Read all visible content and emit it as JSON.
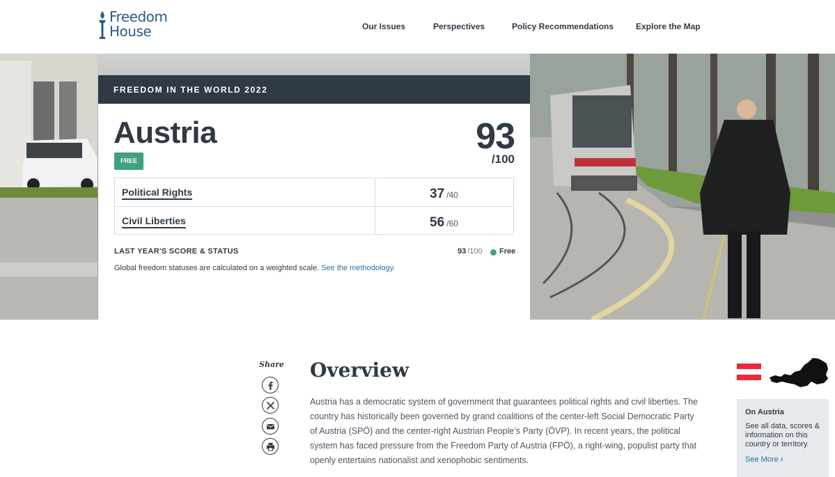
{
  "brand": {
    "line1": "Freedom",
    "line2": "House",
    "color": "#2a5b8a"
  },
  "nav": [
    "Our Issues",
    "Perspectives",
    "Policy Recommendations",
    "Explore the Map"
  ],
  "card": {
    "heading": "FREEDOM IN THE WORLD 2022",
    "country": "Austria",
    "status_badge": "FREE",
    "total_score": "93",
    "total_max": "/100",
    "rows": [
      {
        "label": "Political Rights",
        "score": "37",
        "max": "/40"
      },
      {
        "label": "Civil Liberties",
        "score": "56",
        "max": "/60"
      }
    ],
    "last_year": {
      "label": "LAST YEAR'S SCORE & STATUS",
      "score": "93",
      "max": "/100",
      "status": "Free"
    },
    "note": "Global freedom statuses are calculated on a weighted scale.",
    "note_link": "See the methodology.",
    "colors": {
      "header": "#2f3a45",
      "free": "#3fa27d"
    }
  },
  "share": {
    "label": "Share",
    "icons": [
      "facebook-icon",
      "x-icon",
      "email-icon",
      "print-icon"
    ]
  },
  "overview": {
    "title": "Overview",
    "text": "Austria has a democratic system of government that guarantees political rights and civil liberties. The country has historically been governed by grand coalitions of the center-left Social Democratic Party of Austria (SPÖ) and the center-right Austrian People’s Party (ÖVP). In recent years, the political system has faced pressure from the Freedom Party of Austria (FPÖ), a right-wing, populist party that openly entertains nationalist and xenophobic sentiments."
  },
  "sidebar": {
    "title": "On Austria",
    "text": "See all data, scores & information on this country or territory.",
    "link": "See More",
    "flag_colors": [
      "#ed2939",
      "#ffffff",
      "#ed2939"
    ]
  }
}
